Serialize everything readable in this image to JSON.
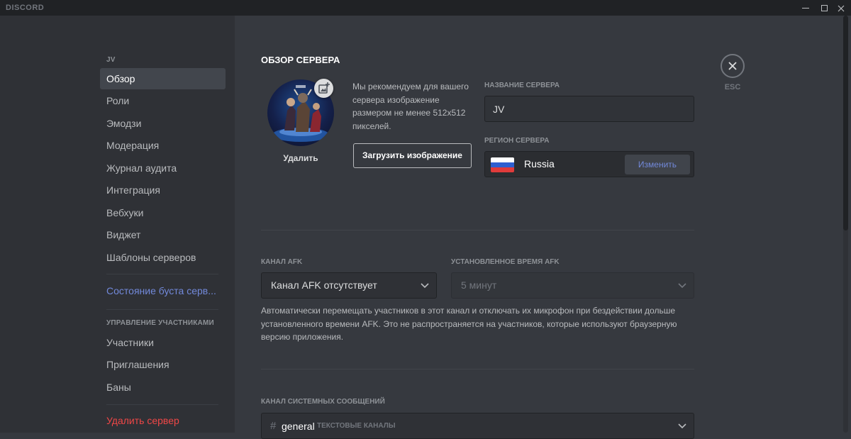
{
  "app": {
    "brand": "DISCORD"
  },
  "window": {
    "minimize_icon": "minimize-icon",
    "maximize_icon": "maximize-icon",
    "close_icon": "close-icon"
  },
  "sidebar": {
    "server_name": "JV",
    "items": [
      {
        "label": "Обзор",
        "active": true
      },
      {
        "label": "Роли"
      },
      {
        "label": "Эмодзи"
      },
      {
        "label": "Модерация"
      },
      {
        "label": "Журнал аудита"
      },
      {
        "label": "Интеграция"
      },
      {
        "label": "Вебхуки"
      },
      {
        "label": "Виджет"
      },
      {
        "label": "Шаблоны серверов"
      }
    ],
    "boost_label": "Состояние буста серв...",
    "members_heading": "УПРАВЛЕНИЕ УЧАСТНИКАМИ",
    "member_items": [
      {
        "label": "Участники"
      },
      {
        "label": "Приглашения"
      },
      {
        "label": "Баны"
      }
    ],
    "delete_label": "Удалить сервер"
  },
  "main": {
    "title": "ОБЗОР СЕРВЕРА",
    "avatar": {
      "remove_label": "Удалить",
      "edit_icon": "image-add-icon"
    },
    "recommendation": "Мы рекомендуем для вашего сервера изображение размером не менее 512x512 пикселей.",
    "upload_label": "Загрузить изображение",
    "server_name_label": "НАЗВАНИЕ СЕРВЕРА",
    "server_name_value": "JV",
    "region_label": "РЕГИОН СЕРВЕРА",
    "region_value": "Russia",
    "region_flag": "russia-flag-icon",
    "change_label": "Изменить",
    "afk_channel_label": "КАНАЛ AFK",
    "afk_channel_value": "Канал AFK отсутствует",
    "afk_timeout_label": "УСТАНОВЛЕННОЕ ВРЕМЯ AFK",
    "afk_timeout_value": "5 минут",
    "afk_description": "Автоматически перемещать участников в этот канал и отключать их микрофон при бездействии дольше установленного времени AFK. Это не распространяется на участников, которые используют браузерную версию приложения.",
    "system_channel_label": "КАНАЛ СИСТЕМНЫХ СООБЩЕНИЙ",
    "system_channel_value": "general",
    "system_channel_category": "ТЕКСТОВЫЕ КАНАЛЫ"
  },
  "close": {
    "label": "ESC",
    "icon": "close-icon"
  },
  "colors": {
    "background": "#36393f",
    "sidebar": "#2f3136",
    "accent": "#7289da",
    "danger": "#f04747"
  }
}
